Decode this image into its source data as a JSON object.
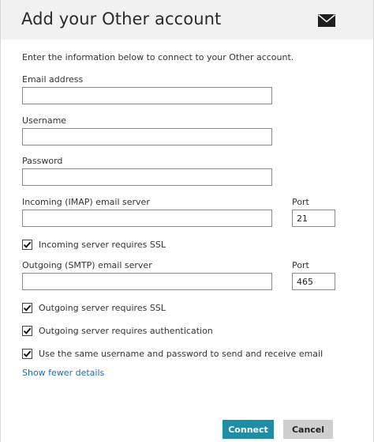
{
  "header": {
    "title": "Add your Other account",
    "icon": "mail-icon"
  },
  "intro": "Enter the information below to connect to your Other account.",
  "fields": {
    "email": {
      "label": "Email address",
      "value": ""
    },
    "username": {
      "label": "Username",
      "value": ""
    },
    "password": {
      "label": "Password",
      "value": ""
    },
    "incoming_server": {
      "label": "Incoming (IMAP) email server",
      "value": ""
    },
    "incoming_port": {
      "label": "Port",
      "value": "21"
    },
    "outgoing_server": {
      "label": "Outgoing (SMTP) email server",
      "value": ""
    },
    "outgoing_port": {
      "label": "Port",
      "value": "465"
    }
  },
  "checkboxes": {
    "incoming_ssl": {
      "label": "Incoming server requires SSL",
      "checked": true
    },
    "outgoing_ssl": {
      "label": "Outgoing server requires SSL",
      "checked": true
    },
    "outgoing_auth": {
      "label": "Outgoing server requires authentication",
      "checked": true
    },
    "same_credentials": {
      "label": "Use the same username and password to send and receive email",
      "checked": true
    }
  },
  "links": {
    "show_fewer": "Show fewer details"
  },
  "buttons": {
    "connect": "Connect",
    "cancel": "Cancel"
  },
  "colors": {
    "header_bg": "#f1f1f1",
    "accent": "#1d8ea6",
    "link": "#1c70b3",
    "secondary_button": "#cfcfcf"
  }
}
